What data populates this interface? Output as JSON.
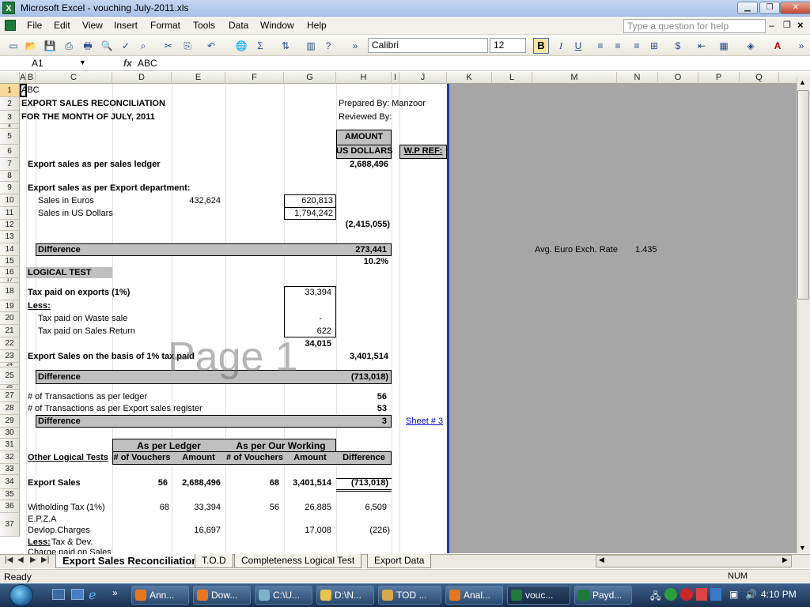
{
  "window": {
    "title": "Microsoft Excel - vouching July-2011.xls"
  },
  "menu": [
    "File",
    "Edit",
    "View",
    "Insert",
    "Format",
    "Tools",
    "Data",
    "Window",
    "Help"
  ],
  "help_placeholder": "Type a question for help",
  "toolbar": {
    "font": "Calibri",
    "size": "12",
    "bold": "B",
    "italic": "I",
    "underline": "U"
  },
  "formula": {
    "namebox": "A1",
    "fx": "fx",
    "content": "ABC"
  },
  "columns": [
    "A",
    "B",
    "C",
    "D",
    "E",
    "F",
    "G",
    "H",
    "I",
    "J",
    "K",
    "L",
    "M",
    "N",
    "O",
    "P",
    "Q"
  ],
  "rows": [
    "1",
    "2",
    "3",
    "4",
    "5",
    "6",
    "7",
    "8",
    "9",
    "10",
    "11",
    "12",
    "13",
    "14",
    "15",
    "16",
    "17",
    "18",
    "19",
    "20",
    "21",
    "22",
    "23",
    "24",
    "25",
    "26",
    "27",
    "28",
    "29",
    "30",
    "31",
    "32",
    "33",
    "34",
    "35",
    "36",
    "37"
  ],
  "sheet": {
    "a1": "ABC",
    "title": "EXPORT SALES RECONCILIATION",
    "period": "FOR THE MONTH OF JULY, 2011",
    "prepared_by": "Prepared By: Manzoor",
    "reviewed_by": "Reviewed By:",
    "amount_hdr": "AMOUNT",
    "usd_hdr": "US DOLLARS",
    "wp_ref": "W.P REF:",
    "r7_label": "Export sales as per sales ledger",
    "r7_value": "2,688,496",
    "r9_label": "Export sales as per Export department:",
    "r10_label": "Sales in Euros",
    "r10_e": "432,624",
    "r10_g": "620,813",
    "r11_label": "Sales in US Dollars",
    "r11_g": "1,794,242",
    "r12_h": "(2,415,055)",
    "r14_label": "Difference",
    "r14_h": "273,441",
    "r15_h": "10.2%",
    "avg_rate_label": "Avg. Euro Exch. Rate",
    "avg_rate_value": "1.435",
    "r16_label": "LOGICAL TEST",
    "r18_label": "Tax paid on exports (1%)",
    "r18_g": "33,394",
    "r19_label": "Less:",
    "r20_label": "Tax paid on Waste sale",
    "r20_g": "-",
    "r21_label": "Tax paid on Sales Return",
    "r21_g": "622",
    "r22_g": "34,015",
    "r23_label": "Export Sales on the basis of 1% tax paid",
    "r23_h": "3,401,514",
    "r25_label": "Difference",
    "r25_h": "(713,018)",
    "r27_label": "# of Transactions as per ledger",
    "r27_h": "56",
    "r28_label": "# of Transactions as per Export sales register",
    "r28_h": "53",
    "r29_label": "Difference",
    "r29_h": "3",
    "r29_j": "Sheet # 3",
    "as_per_ledger": "As per Ledger",
    "as_per_working": "As per Our Working",
    "other_tests": "Other Logical Tests",
    "num_vouchers": "# of Vouchers",
    "amount": "Amount",
    "difference": "Difference",
    "r34_label": "Export Sales",
    "r34_d": "56",
    "r34_e": "2,688,496",
    "r34_f": "68",
    "r34_g": "3,401,514",
    "r34_h": "(713,018)",
    "r36_label": "Witholding Tax (1%)",
    "r36_d": "68",
    "r36_e": "33,394",
    "r36_f": "56",
    "r36_g": "26,885",
    "r36_h": "6,509",
    "r37_label1": "E.P.Z.A",
    "r37_label2": "Devlop.Charges",
    "r37_e": "16,697",
    "r37_g": "17,008",
    "r37_h": "(226)",
    "r38_less": "Less:",
    "r38_label": "Tax & Dev.",
    "r39_label": "Charge paid on Sales"
  },
  "watermark": "Page 1",
  "tabs": [
    "Export Sales Reconciliation",
    "T.O.D",
    "Completeness Logical Test",
    "Export Data"
  ],
  "status": {
    "left": "Ready",
    "num": "NUM"
  },
  "taskbar": {
    "items": [
      "Ann...",
      "Dow...",
      "C:\\U...",
      "D:\\N...",
      "TOD ...",
      "Anal...",
      "vouc...",
      "Payd..."
    ],
    "time": "4:10 PM"
  }
}
